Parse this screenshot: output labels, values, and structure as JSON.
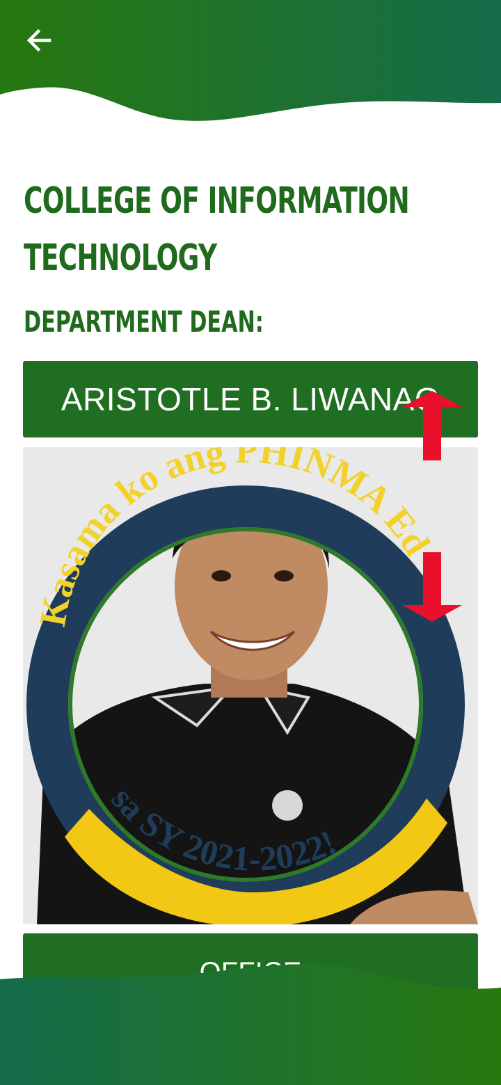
{
  "header": {
    "back_icon": "arrow-left-icon",
    "colors": {
      "gradient_start": "#27780f",
      "gradient_end": "#156c4a"
    }
  },
  "college": {
    "title": "COLLEGE OF INFORMATION TECHNOLOGY",
    "dean_heading": "DEPARTMENT DEAN:",
    "dean_name": "ARISTOTLE B. LIWANAG"
  },
  "photo_frame": {
    "ring_text_top": "Kasama ko ang PHINMA Ed",
    "ring_text_bottom": "sa SY 2021-2022!",
    "ring_color": "#1f3d5a",
    "banner_color": "#f2c814",
    "text_color": "#f2d22a"
  },
  "buttons": {
    "office_label": "OFFICE"
  },
  "annotations": {
    "arrow_color": "#e8102a",
    "arrow_up": "arrow-up-icon",
    "arrow_down": "arrow-down-icon"
  }
}
